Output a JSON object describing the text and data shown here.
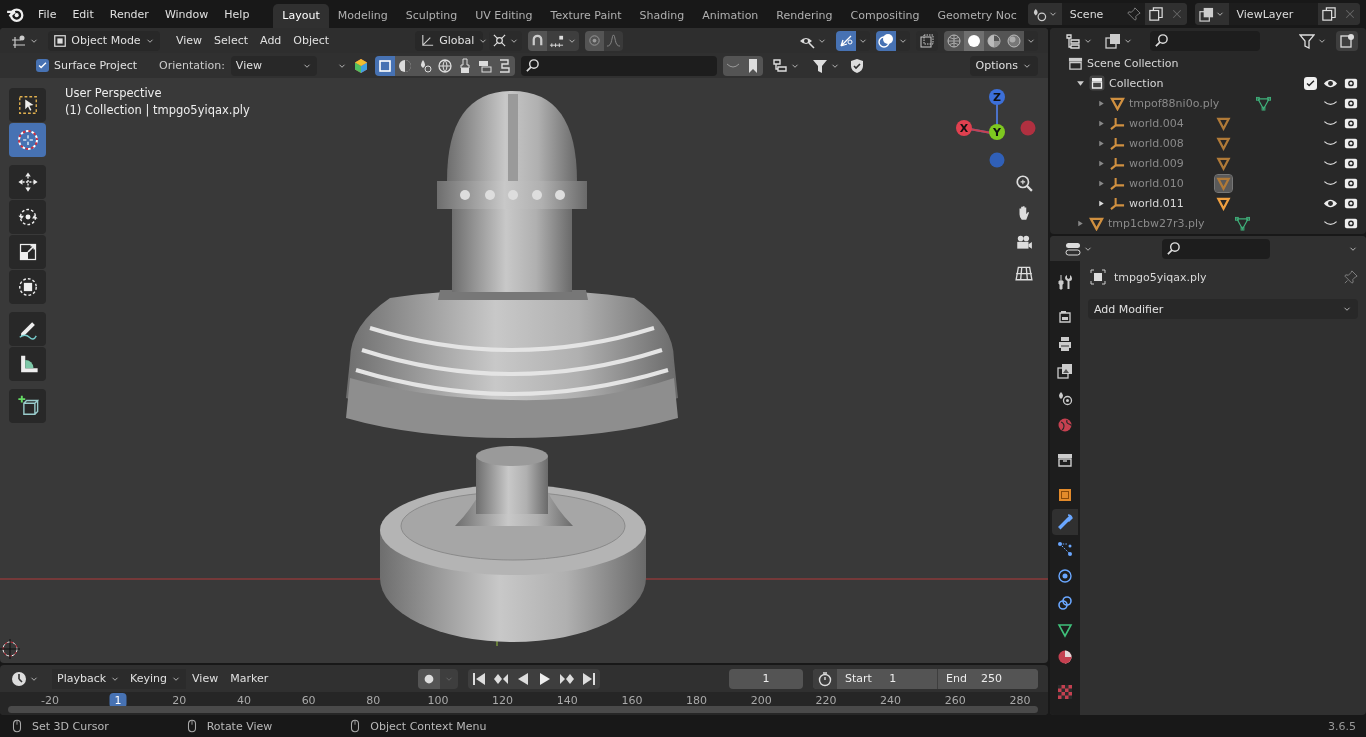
{
  "menubar": {
    "menus": [
      "File",
      "Edit",
      "Render",
      "Window",
      "Help"
    ]
  },
  "workspaces": [
    {
      "label": "Layout",
      "selected": true
    },
    {
      "label": "Modeling",
      "selected": false
    },
    {
      "label": "Sculpting",
      "selected": false
    },
    {
      "label": "UV Editing",
      "selected": false
    },
    {
      "label": "Texture Paint",
      "selected": false
    },
    {
      "label": "Shading",
      "selected": false
    },
    {
      "label": "Animation",
      "selected": false
    },
    {
      "label": "Rendering",
      "selected": false
    },
    {
      "label": "Compositing",
      "selected": false
    },
    {
      "label": "Geometry Noc",
      "selected": false
    }
  ],
  "scene": {
    "value": "Scene"
  },
  "view_layer": {
    "value": "ViewLayer"
  },
  "viewport_header": {
    "mode": "Object Mode",
    "menus": [
      "View",
      "Select",
      "Add",
      "Object"
    ],
    "transform_orientation": "Global",
    "gizmo_on": true,
    "overlays_on": true,
    "shading": [
      {
        "kind": "wireframe",
        "selected": false
      },
      {
        "kind": "solid",
        "selected": true
      },
      {
        "kind": "material",
        "selected": false
      },
      {
        "kind": "rendered",
        "selected": false
      }
    ]
  },
  "tool_settings": {
    "surface_project": {
      "label": "Surface Project",
      "checked": true
    },
    "orientation_label": "Orientation:",
    "orientation_value": "View",
    "options": "Options",
    "snap_elements": [
      {
        "kind": "object",
        "selected": true
      },
      {
        "kind": "material",
        "selected": false
      },
      {
        "kind": "particles",
        "selected": false
      },
      {
        "kind": "world",
        "selected": false
      },
      {
        "kind": "brush",
        "selected": false
      },
      {
        "kind": "layers",
        "selected": false
      },
      {
        "kind": "surface",
        "selected": false
      }
    ]
  },
  "viewport": {
    "view_name": "User Perspective",
    "context": "(1) Collection | tmpgo5yiqax.ply",
    "axes": [
      {
        "label": "Z"
      },
      {
        "label": "X"
      },
      {
        "label": "Y"
      }
    ]
  },
  "toolbar": [
    {
      "kind": "select_box",
      "selected": false
    },
    {
      "kind": "cursor",
      "selected": true
    },
    {
      "kind": "move",
      "selected": false
    },
    {
      "kind": "rotate",
      "selected": false
    },
    {
      "kind": "scale",
      "selected": false
    },
    {
      "kind": "transform",
      "selected": false
    },
    {
      "kind": "annotate",
      "selected": false
    },
    {
      "kind": "measure",
      "selected": false
    },
    {
      "kind": "add_cube",
      "selected": false
    }
  ],
  "outliner": {
    "root": {
      "name": "Scene Collection",
      "kind": "scene_collection",
      "children": [
        {
          "name": "Collection",
          "kind": "collection",
          "expanded": true,
          "checked": true,
          "hidden": false,
          "children": [
            {
              "name": "tmpof88ni0o.ply",
              "kind": "mesh",
              "expanded": false,
              "hidden": true,
              "highlighted": false
            },
            {
              "name": "world.004",
              "kind": "empty",
              "expanded": false,
              "hidden": true,
              "highlighted": false
            },
            {
              "name": "world.008",
              "kind": "empty",
              "expanded": false,
              "hidden": true,
              "highlighted": false
            },
            {
              "name": "world.009",
              "kind": "empty",
              "expanded": false,
              "hidden": true,
              "highlighted": false
            },
            {
              "name": "world.010",
              "kind": "empty",
              "expanded": false,
              "hidden": true,
              "highlighted": true
            },
            {
              "name": "world.011",
              "kind": "empty",
              "expanded": false,
              "hidden": false,
              "highlighted": false
            }
          ]
        },
        {
          "name": "tmp1cbw27r3.ply",
          "kind": "mesh",
          "expanded": false,
          "hidden": true,
          "highlighted": false
        }
      ]
    }
  },
  "properties": {
    "object_name": "tmpgo5yiqax.ply",
    "add_modifier": "Add Modifier",
    "tab_groups": [
      [
        {
          "kind": "tool",
          "selected": false
        }
      ],
      [
        {
          "kind": "render",
          "selected": false
        },
        {
          "kind": "output",
          "selected": false
        },
        {
          "kind": "view_layer",
          "selected": false
        },
        {
          "kind": "scene",
          "selected": false
        },
        {
          "kind": "world",
          "selected": false
        }
      ],
      [
        {
          "kind": "collection",
          "selected": false
        }
      ],
      [
        {
          "kind": "object",
          "selected": false
        },
        {
          "kind": "modifiers",
          "selected": true
        },
        {
          "kind": "particles",
          "selected": false
        },
        {
          "kind": "physics",
          "selected": false
        },
        {
          "kind": "constraints",
          "selected": false
        },
        {
          "kind": "data",
          "selected": false
        },
        {
          "kind": "material",
          "selected": false
        }
      ],
      [
        {
          "kind": "texture",
          "selected": false
        }
      ]
    ]
  },
  "timeline": {
    "menus": [
      {
        "label": "Playback",
        "dropdown": true
      },
      {
        "label": "Keying",
        "dropdown": true
      },
      {
        "label": "View",
        "dropdown": false
      },
      {
        "label": "Marker",
        "dropdown": false
      }
    ],
    "current_frame": "1",
    "start_label": "Start",
    "start": "1",
    "end_label": "End",
    "end": "250",
    "ruler": [
      {
        "label": "-20",
        "selected": false
      },
      {
        "label": "1",
        "selected": true
      },
      {
        "label": "20",
        "selected": false
      },
      {
        "label": "40",
        "selected": false
      },
      {
        "label": "60",
        "selected": false
      },
      {
        "label": "80",
        "selected": false
      },
      {
        "label": "100",
        "selected": false
      },
      {
        "label": "120",
        "selected": false
      },
      {
        "label": "140",
        "selected": false
      },
      {
        "label": "160",
        "selected": false
      },
      {
        "label": "180",
        "selected": false
      },
      {
        "label": "200",
        "selected": false
      },
      {
        "label": "220",
        "selected": false
      },
      {
        "label": "240",
        "selected": false
      },
      {
        "label": "260",
        "selected": false
      },
      {
        "label": "280",
        "selected": false
      }
    ]
  },
  "status_bar": {
    "hints": [
      "Set 3D Cursor",
      "Rotate View",
      "Object Context Menu"
    ],
    "version": "3.6.5"
  }
}
